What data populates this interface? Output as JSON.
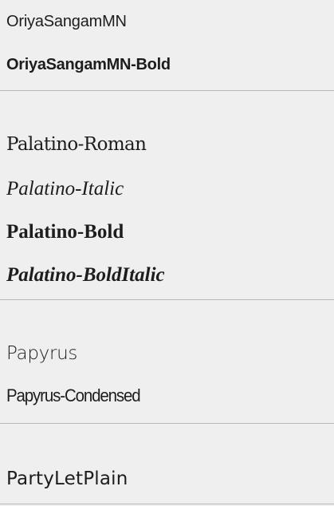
{
  "font_list": {
    "groups": [
      {
        "items": [
          {
            "label": "OriyaSangamMN"
          },
          {
            "label": "OriyaSangamMN-Bold"
          }
        ]
      },
      {
        "items": [
          {
            "label": "Palatino-Roman"
          },
          {
            "label": "Palatino-Italic"
          },
          {
            "label": "Palatino-Bold"
          },
          {
            "label": "Palatino-BoldItalic"
          }
        ]
      },
      {
        "items": [
          {
            "label": "Papyrus"
          },
          {
            "label": "Papyrus-Condensed"
          }
        ]
      },
      {
        "items": [
          {
            "label": "PartyLetPlain"
          }
        ]
      }
    ]
  },
  "colors": {
    "background": "#efefef",
    "text": "#1d1d1d",
    "divider": "#b8b8b8"
  }
}
